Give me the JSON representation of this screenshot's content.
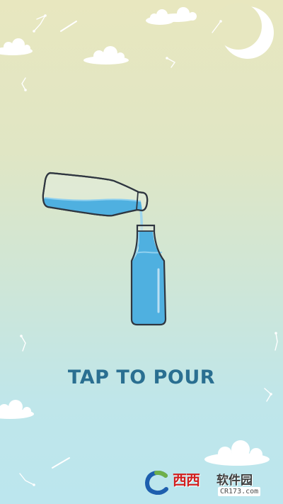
{
  "screen": {
    "prompt_label": "TAP TO POUR"
  },
  "colors": {
    "sky_top": "#e8e7bf",
    "sky_bottom": "#bce6ee",
    "water": "#4fb0e0",
    "prompt_text": "#2a6f91"
  },
  "watermark": {
    "brand": "西西",
    "site_cn": "软件园",
    "url": "CR173.com"
  },
  "icons": [
    "moon-icon",
    "cloud-icon",
    "constellation-icon",
    "shooting-star-icon"
  ]
}
